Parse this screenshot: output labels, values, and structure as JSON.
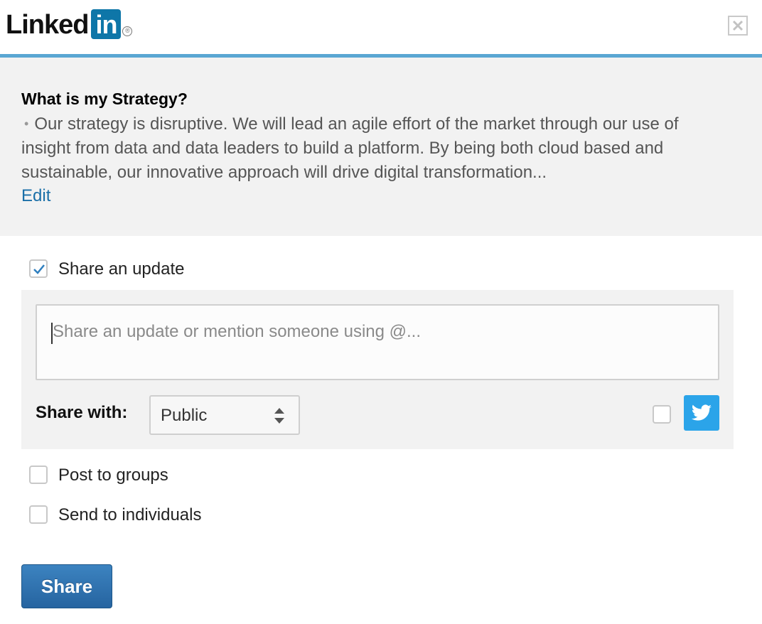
{
  "header": {
    "logo_word": "Linked",
    "logo_box": "in",
    "logo_reg": "®"
  },
  "strategy": {
    "title": "What is my Strategy?",
    "bullet": "•",
    "body": "Our strategy is disruptive. We will lead an agile effort of the market through our use of insight from data and data leaders to build a platform. By being both cloud based and sustainable, our innovative approach will drive digital transformation...",
    "edit_label": "Edit"
  },
  "share_update": {
    "label": "Share an update",
    "checked": true,
    "placeholder": "Share an update or mention someone using @...",
    "share_with_label": "Share with:",
    "visibility_value": "Public",
    "twitter_checked": false
  },
  "options": {
    "post_to_groups": "Post to groups",
    "send_to_individuals": "Send to individuals"
  },
  "actions": {
    "share_label": "Share"
  },
  "colors": {
    "brand": "#0e76a8",
    "header_rule": "#5aa7d3",
    "link": "#1a6fa8",
    "twitter": "#2ba4e9",
    "button": "#2d6ead"
  },
  "icons": {
    "close": "close-icon",
    "check": "checkmark-icon",
    "select_arrows": "sort-arrows-icon",
    "twitter": "twitter-bird-icon"
  }
}
